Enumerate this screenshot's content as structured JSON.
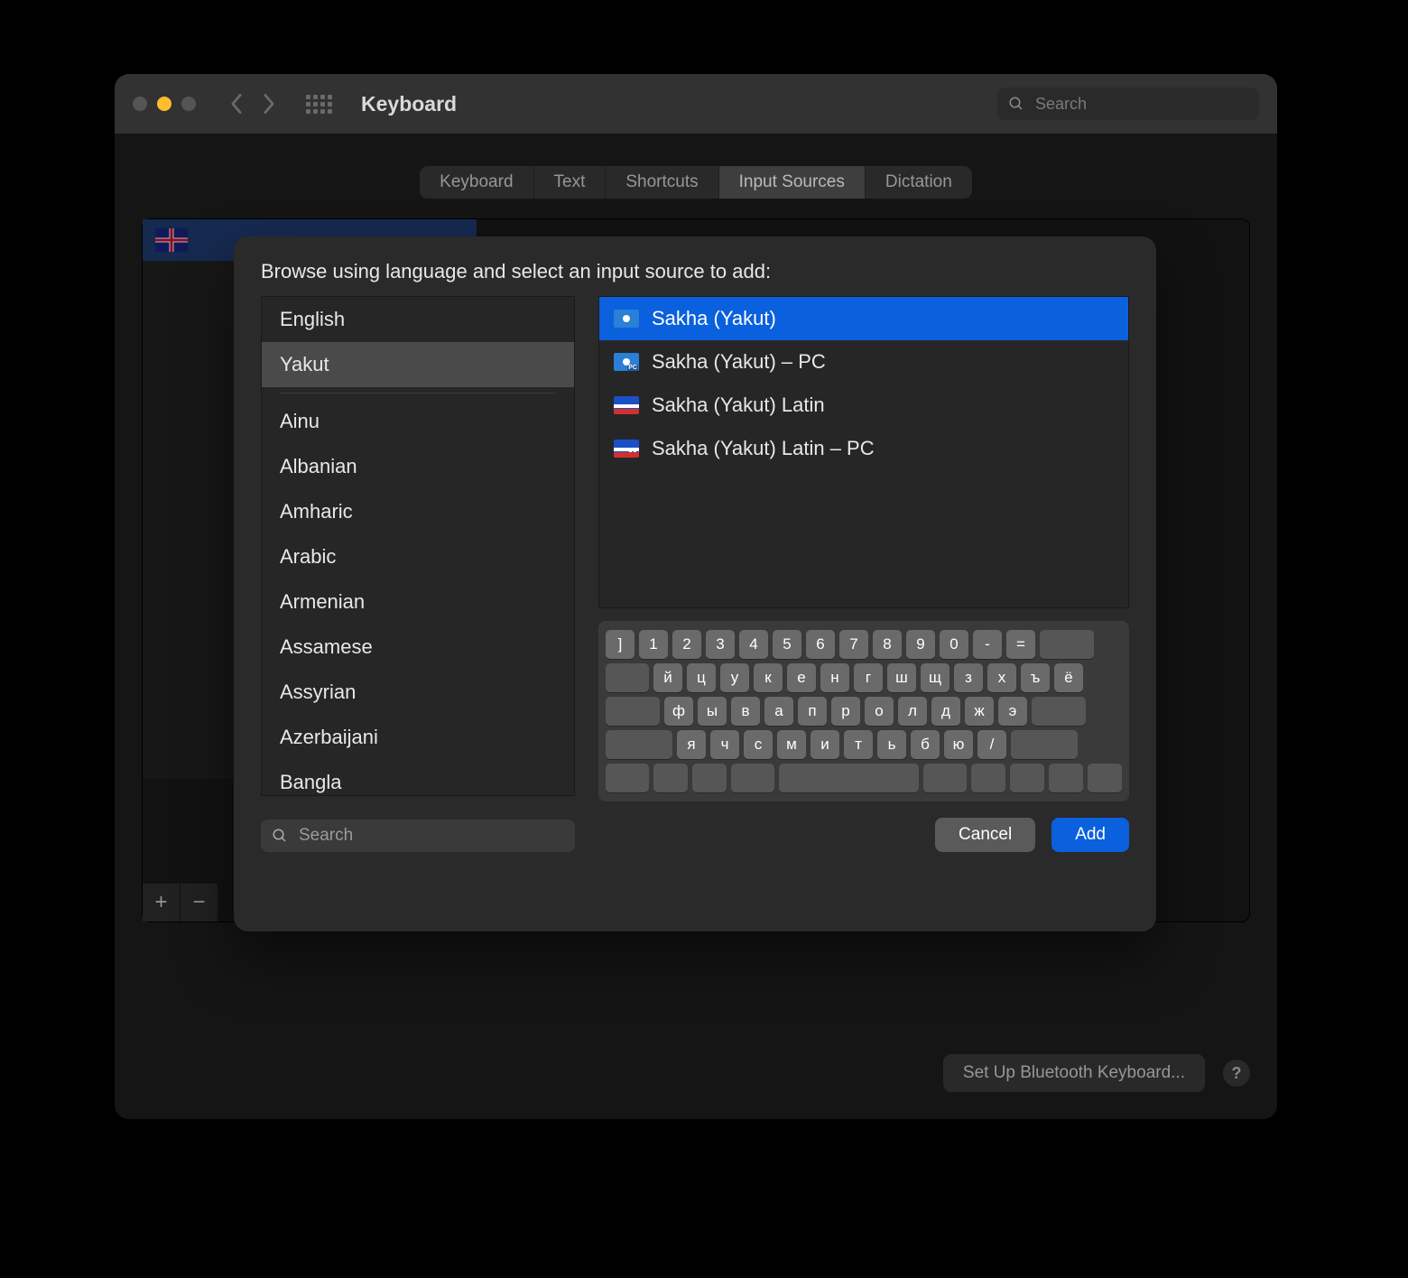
{
  "titlebar": {
    "title": "Keyboard",
    "search_placeholder": "Search"
  },
  "tabs": {
    "keyboard": "Keyboard",
    "text": "Text",
    "shortcuts": "Shortcuts",
    "input_sources": "Input Sources",
    "dictation": "Dictation"
  },
  "bottom": {
    "bluetooth": "Set Up Bluetooth Keyboard...",
    "help": "?"
  },
  "panel_controls": {
    "add": "+",
    "remove": "−"
  },
  "sheet": {
    "title": "Browse using language and select an input source to add:",
    "search_placeholder": "Search",
    "cancel": "Cancel",
    "add": "Add",
    "languages": {
      "english": "English",
      "yakut": "Yakut",
      "ainu": "Ainu",
      "albanian": "Albanian",
      "amharic": "Amharic",
      "arabic": "Arabic",
      "armenian": "Armenian",
      "assamese": "Assamese",
      "assyrian": "Assyrian",
      "azerbaijani": "Azerbaijani",
      "bangla": "Bangla"
    },
    "sources": {
      "sakha": "Sakha (Yakut)",
      "sakha_pc": "Sakha (Yakut) – PC",
      "sakha_latin": "Sakha (Yakut) Latin",
      "sakha_latin_pc": "Sakha (Yakut) Latin – PC"
    },
    "keyboard_rows": [
      [
        "]",
        "1",
        "2",
        "3",
        "4",
        "5",
        "6",
        "7",
        "8",
        "9",
        "0",
        "-",
        "="
      ],
      [
        "й",
        "ц",
        "у",
        "к",
        "е",
        "н",
        "г",
        "ш",
        "щ",
        "з",
        "х",
        "ъ",
        "ё"
      ],
      [
        "ф",
        "ы",
        "в",
        "а",
        "п",
        "р",
        "о",
        "л",
        "д",
        "ж",
        "э"
      ],
      [
        "я",
        "ч",
        "с",
        "м",
        "и",
        "т",
        "ь",
        "б",
        "ю",
        "/"
      ]
    ]
  }
}
